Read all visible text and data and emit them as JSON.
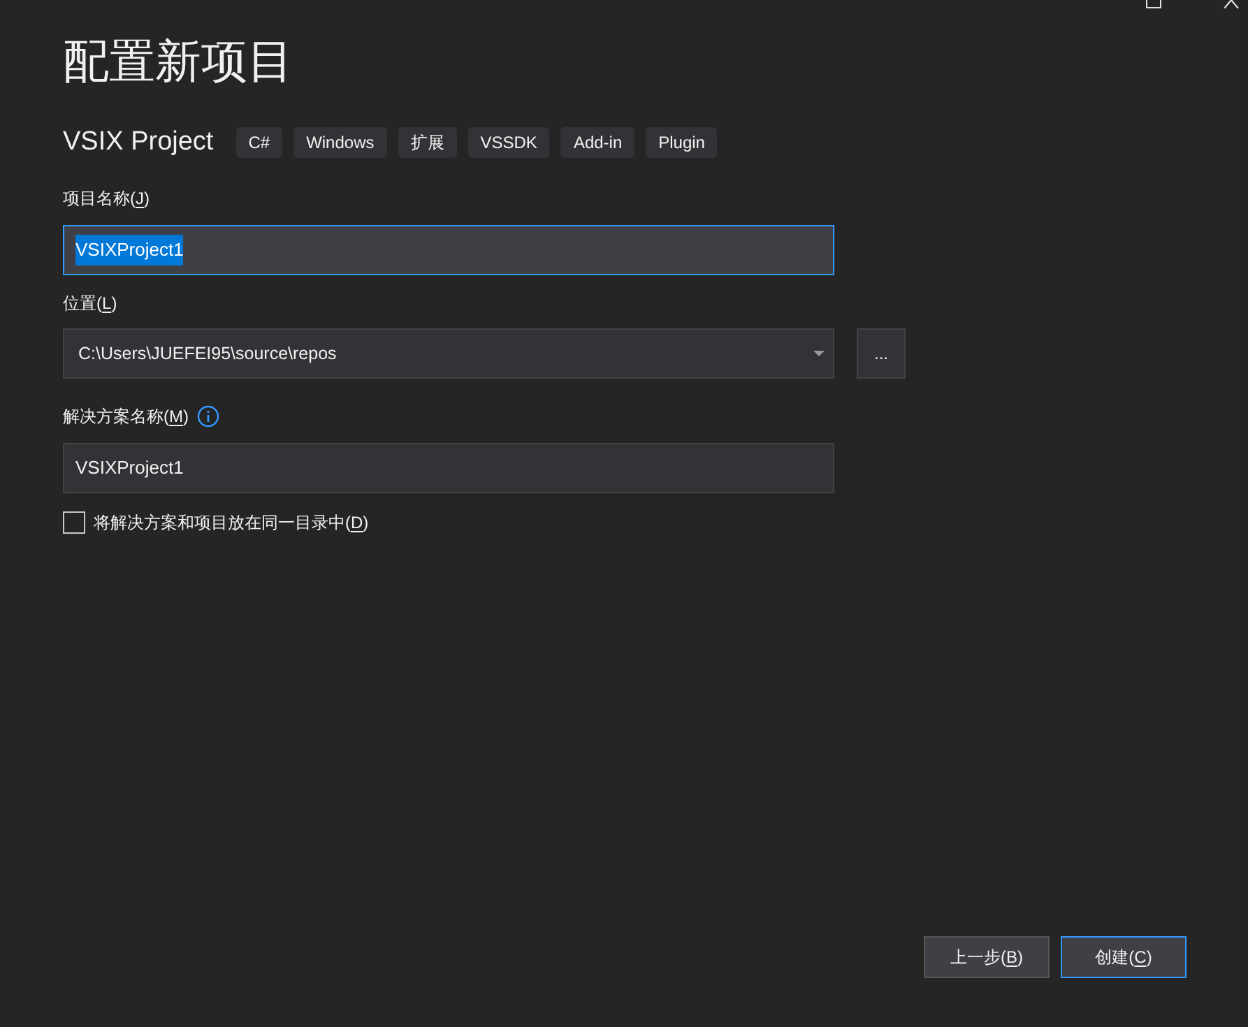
{
  "window": {
    "controls": [
      {
        "kind": "maximize"
      },
      {
        "kind": "close"
      }
    ]
  },
  "title": "配置新项目",
  "template": {
    "name": "VSIX Project",
    "tags": [
      "C#",
      "Windows",
      "扩展",
      "VSSDK",
      "Add-in",
      "Plugin"
    ]
  },
  "fields": [
    {
      "kind": "text",
      "label_before": "项目名称(",
      "access_key": "J",
      "label_after": ")",
      "value": "VSIXProject1",
      "focused": true,
      "info": false
    },
    {
      "kind": "combo",
      "label_before": "位置(",
      "access_key": "L",
      "label_after": ")",
      "value": "C:\\Users\\JUEFEI95\\source\\repos",
      "focused": false,
      "info": false,
      "browse_button": "..."
    },
    {
      "kind": "text",
      "label_before": "解决方案名称(",
      "access_key": "M",
      "label_after": ")",
      "value": "VSIXProject1",
      "focused": false,
      "info": true
    }
  ],
  "same_directory": {
    "label_before": "将解决方案和项目放在同一目录中(",
    "access_key": "D",
    "label_after": ")",
    "checked": false
  },
  "buttons": [
    {
      "label_before": "上一步(",
      "access_key": "B",
      "label_after": ")",
      "default": false
    },
    {
      "label_before": "创建(",
      "access_key": "C",
      "label_after": ")",
      "default": true
    }
  ]
}
